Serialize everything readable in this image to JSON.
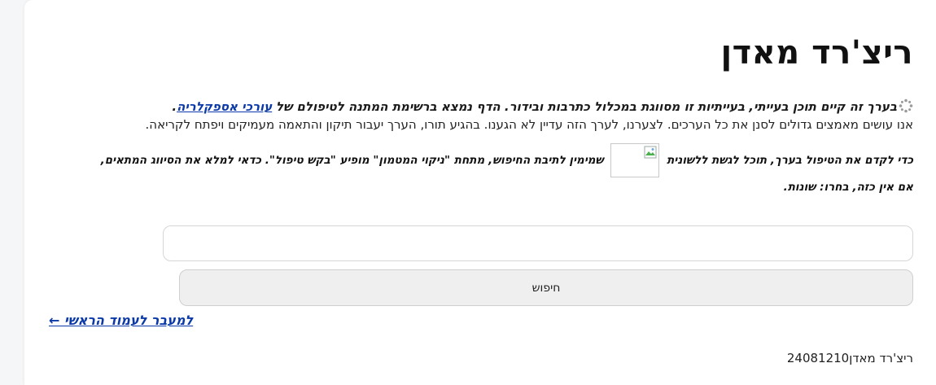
{
  "page": {
    "title": "ריצ'רד מאדן"
  },
  "notice": {
    "bold_text": "בערך זה קיים תוכן בעייתי, בעייתיות זו מסווגת במכלול כתרבות ובידור. הדף נמצא ברשימת המתנה לטיפולם של",
    "link_text": "עורכי אספקלריה",
    "period": ".",
    "second_line": "אנו עושים מאמצים גדולים לסנן את כל הערכים. לצערנו, לערך הזה עדיין לא הגענו. בהגיע תורו, הערך יעבור תיקון והתאמה מעמיקים ויפתח לקריאה."
  },
  "instructions": {
    "part1": "כדי לקדם את הטיפול בערך, תוכל לגשת ללשונית",
    "part2": "שמימין לתיבת החיפוש, מתחת \"ניקוי המטמון\" מופיע \"בקש טיפול\". כדאי למלא את הסיווג המתאים,",
    "part3": "אם אין כזה, בחרו: שונות."
  },
  "search": {
    "input_value": "",
    "button_label": "חיפוש"
  },
  "nav": {
    "home_link": "למעבר לעמוד הראשי ←"
  },
  "footer": {
    "text": "ריצ'רד מאדן24081210"
  }
}
